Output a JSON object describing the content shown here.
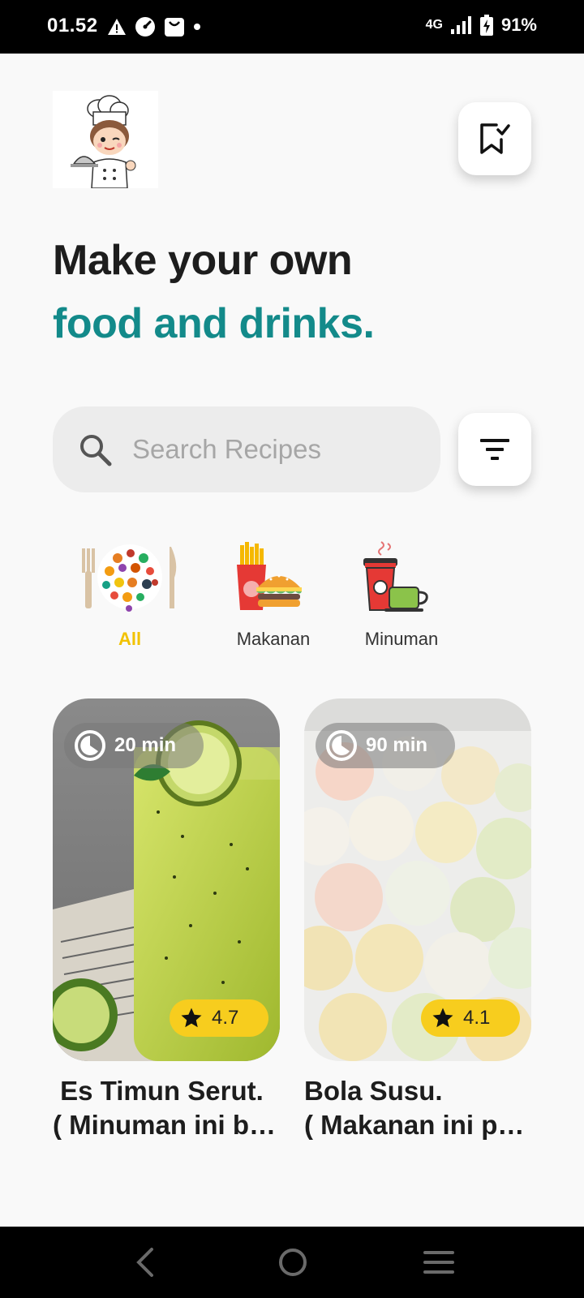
{
  "status_bar": {
    "time": "01.52",
    "network": "4G",
    "battery": "91%",
    "icons": [
      "warning-icon",
      "speed-icon",
      "shopping-bag-icon",
      "dot-icon",
      "signal-icon",
      "battery-charging-icon"
    ]
  },
  "header": {
    "logo": "chef-mascot-logo",
    "bookmark_icon": "bookmark-check-icon"
  },
  "headline": {
    "line1": "Make your own",
    "line2": "food and drinks."
  },
  "search": {
    "placeholder": "Search Recipes",
    "value": ""
  },
  "filter_icon": "filter-lines-icon",
  "categories": [
    {
      "label": "All",
      "icon": "food-plate-icon",
      "active": true
    },
    {
      "label": "Makanan",
      "icon": "burger-fries-icon",
      "active": false
    },
    {
      "label": "Minuman",
      "icon": "coffee-cups-icon",
      "active": false
    }
  ],
  "recipes": [
    {
      "time": "20 min",
      "rating": "4.7",
      "title_line1": "Es Timun Serut.",
      "title_line2": "( Minuman ini b…"
    },
    {
      "time": "90 min",
      "rating": "4.1",
      "title_line1": "Bola Susu.",
      "title_line2": "( Makanan ini p…"
    }
  ],
  "nav_bar": [
    "back-icon",
    "home-icon",
    "menu-icon"
  ],
  "colors": {
    "accent_teal": "#138a8a",
    "accent_yellow": "#f2c200",
    "rating_yellow": "#f7cd1e"
  }
}
